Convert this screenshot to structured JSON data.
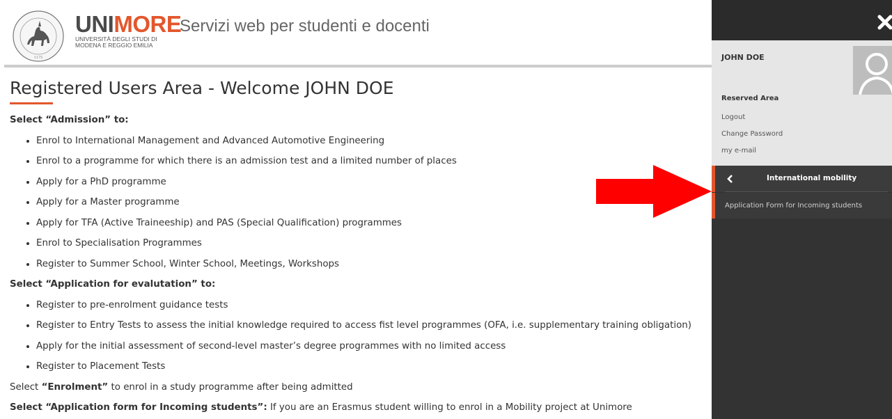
{
  "header": {
    "brand_uni": "UNI",
    "brand_more": "MORE",
    "brand_sub_line1": "UNIVERSITÀ DEGLI STUDI DI",
    "brand_sub_line2": "MODENA E REGGIO EMILIA",
    "site_title": "Servizi web per studenti e docenti",
    "seal_text": "UNIVERSITAS STUDIORUM MUTINENSIS ET REGIENSIS",
    "seal_year": "1175"
  },
  "main": {
    "title": "Registered Users Area - Welcome JOHN DOE",
    "sections": [
      {
        "heading": "Select “Admission” to:",
        "items": [
          "Enrol to International Management and Advanced Automotive Engineering",
          "Enrol to a programme for which there is an admission test and a limited number of places",
          "Apply for a PhD programme",
          "Apply for a Master programme",
          "Apply for TFA (Active Traineeship) and PAS (Special Qualification) programmes",
          "Enrol to Specialisation Programmes",
          "Register to Summer School, Winter School, Meetings, Workshops"
        ]
      },
      {
        "heading": "Select “Application for evalutation” to:",
        "items": [
          "Register to pre-enrolment guidance tests",
          "Register to Entry Tests to assess the initial knowledge required to access fist level programmes (OFA, i.e. supplementary training obligation)",
          "Apply for the initial assessment of second-level master’s degree programmes with no limited access",
          "Register to Placement Tests"
        ]
      }
    ],
    "enrolment_pre": "Select ",
    "enrolment_bold": "“Enrolment”",
    "enrolment_post": " to enrol in a study programme after being admitted",
    "incoming_bold": "Select “Application form for Incoming students”:",
    "incoming_post": " If you are an Erasmus student willing to enrol in a Mobility project at Unimore"
  },
  "sidebar": {
    "close_icon": "close-icon",
    "user_name": "JOHN DOE",
    "reserved_area": "Reserved Area",
    "links": [
      "Logout",
      "Change Password",
      "my e-mail"
    ],
    "menu_title": "International mobility",
    "menu_items": [
      "Application Form for Incoming students"
    ]
  },
  "colors": {
    "accent": "#e3562c",
    "sidebar_bg": "#333333",
    "user_box_bg": "#e6e6e6",
    "arrow": "#ff0000"
  }
}
